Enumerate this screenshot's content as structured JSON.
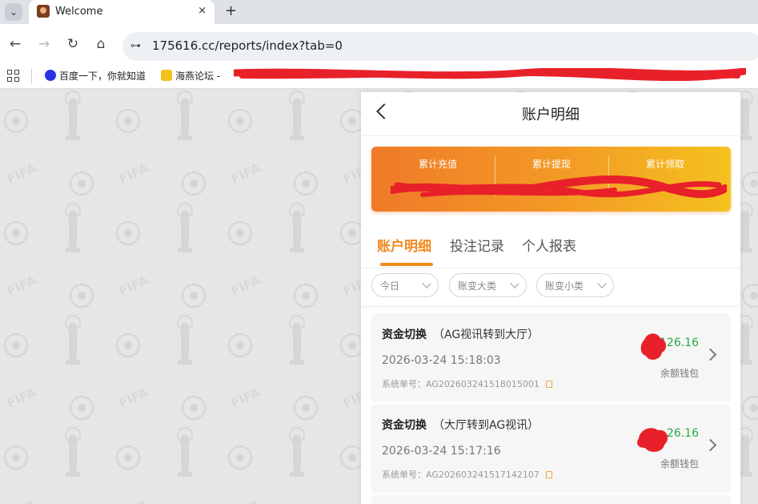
{
  "browser": {
    "tab_title": "Welcome",
    "url": "175616.cc/reports/index?tab=0",
    "bookmarks": [
      {
        "label": "百度一下，你就知道",
        "icon": "baidu-paw-icon"
      },
      {
        "label": "海燕论坛 -",
        "icon": "trophy-icon"
      }
    ],
    "icons": {
      "tab_menu": "chevron-down-icon",
      "close": "×",
      "new_tab": "+",
      "back": "←",
      "forward": "→",
      "reload": "↻",
      "home": "⌂",
      "site_info": "⊶"
    }
  },
  "app": {
    "header_title": "账户明细",
    "stats": [
      {
        "label": "累计充值",
        "value": ""
      },
      {
        "label": "累计提现",
        "value": ""
      },
      {
        "label": "累计领取",
        "value": ""
      }
    ],
    "tabs": [
      {
        "label": "账户明细",
        "active": true
      },
      {
        "label": "投注记录",
        "active": false
      },
      {
        "label": "个人报表",
        "active": false
      }
    ],
    "filters": [
      {
        "label": "今日"
      },
      {
        "label": "账变大类"
      },
      {
        "label": "账变小类"
      }
    ],
    "records": [
      {
        "title": "资金切换",
        "detail": "（AG视讯转到大厅）",
        "time": "2026-03-24 15:18:03",
        "order": "系统单号：AG202603241518015001",
        "amount": "126.16",
        "wallet": "余额钱包"
      },
      {
        "title": "资金切换",
        "detail": "（大厅转到AG视讯）",
        "time": "2026-03-24 15:17:16",
        "order": "系统单号：AG202603241517142107",
        "amount": "26.16",
        "wallet": "余额钱包"
      }
    ]
  },
  "colors": {
    "accent": "#f28a1e",
    "amount_green": "#27a744",
    "redaction": "#e8202a",
    "banner_start": "#f07a28",
    "banner_end": "#f4c21f"
  }
}
